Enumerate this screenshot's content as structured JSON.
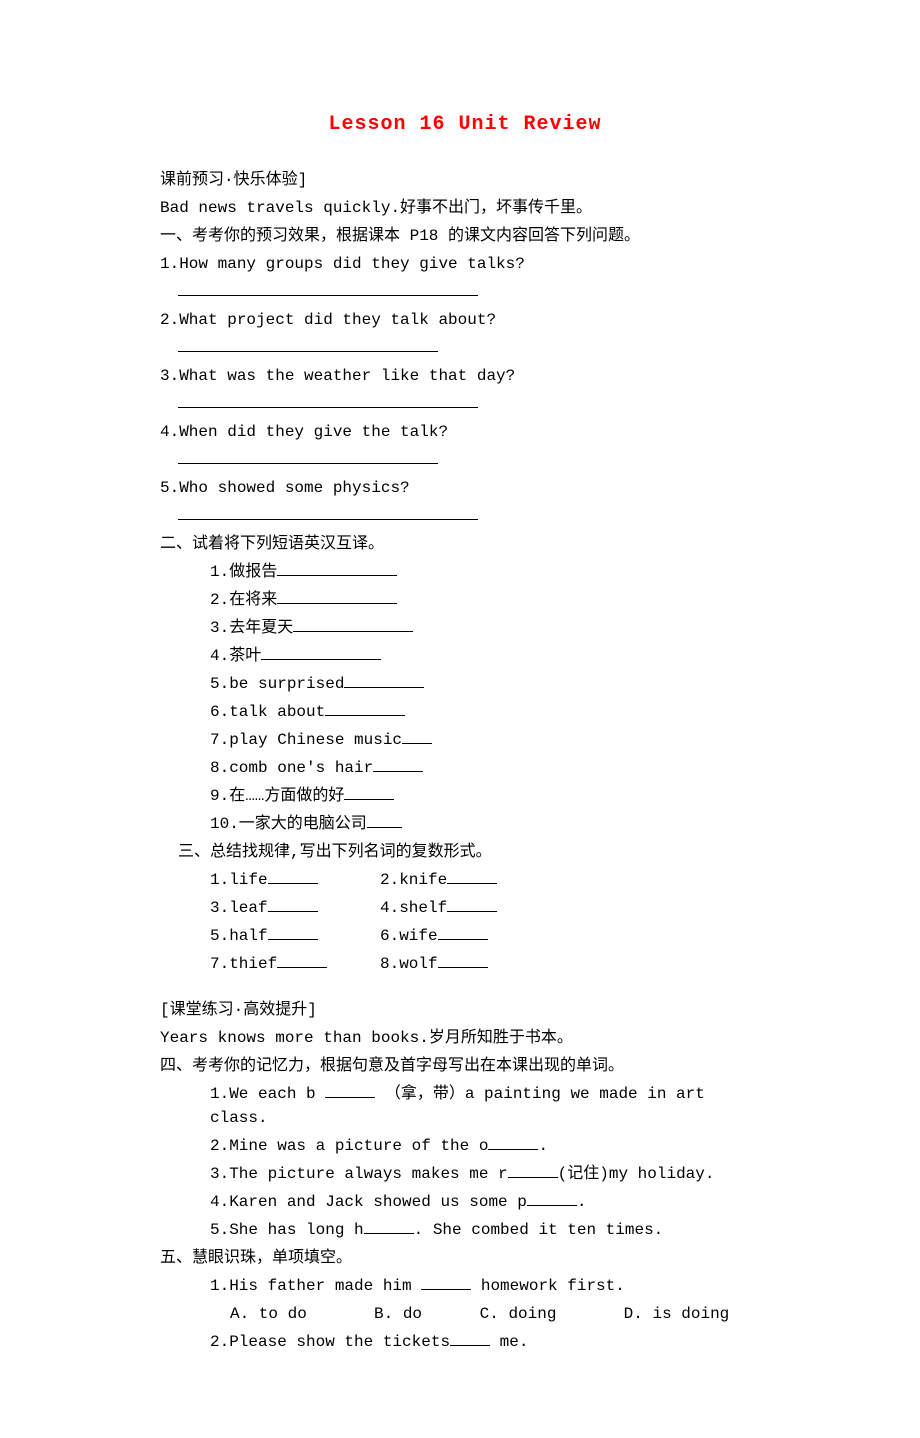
{
  "title": "Lesson 16 Unit Review",
  "preclass_header": "课前预习·快乐体验]",
  "proverb1": "Bad news travels quickly.好事不出门，坏事传千里。",
  "section1_header": "一、考考你的预习效果，根据课本 P18 的课文内容回答下列问题。",
  "q1": "1.How many groups did they give talks?",
  "q2": "2.What project did they talk about?",
  "q3": "3.What was the weather like that day?",
  "q4": "4.When did they give the talk?",
  "q5": "5.Who showed some physics?",
  "section2_header": "二、试着将下列短语英汉互译。",
  "s2": {
    "i1": "1.做报告",
    "i2": "2.在将来",
    "i3": "3.去年夏天",
    "i4": "4.茶叶",
    "i5": "5.be surprised",
    "i6": "6.talk about",
    "i7": "7.play Chinese music",
    "i8": "8.comb one's hair",
    "i9": "9.在……方面做的好",
    "i10": "10.一家大的电脑公司"
  },
  "section3_header": "三、总结找规律,写出下列名词的复数形式。",
  "s3": {
    "i1": "1.life",
    "i2": "2.knife",
    "i3": "3.leaf",
    "i4": "4.shelf",
    "i5": "5.half",
    "i6": "6.wife",
    "i7": "7.thief",
    "i8": "8.wolf"
  },
  "classwork_header": "[课堂练习·高效提升]",
  "proverb2": "Years knows more than books.岁月所知胜于书本。",
  "section4_header": "四、考考你的记忆力，根据句意及首字母写出在本课出现的单词。",
  "s4": {
    "i1a": "1.We each b ",
    "i1b": " （拿，带）a painting we made in art class.",
    "i2a": "2.Mine was a picture of the o",
    "i2b": ".",
    "i3a": "3.The picture always makes me r",
    "i3b": "(记住)my holiday.",
    "i4a": "4.Karen and Jack showed us some p",
    "i4b": ".",
    "i5a": "5.She has long h",
    "i5b": ". She combed it ten times."
  },
  "section5_header": "五、慧眼识珠，单项填空。",
  "s5": {
    "q1a": "1.His father made him ",
    "q1b": " homework first.",
    "q1opts": "A. to do       B. do      C. doing       D. is doing",
    "q2a": "2.Please show the tickets",
    "q2b": " me."
  }
}
